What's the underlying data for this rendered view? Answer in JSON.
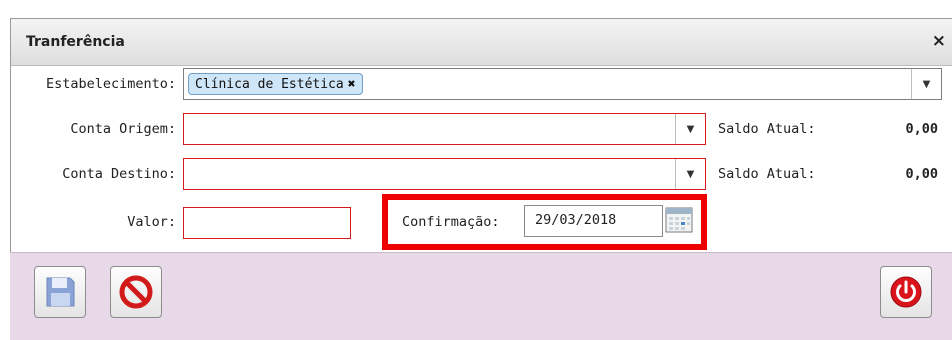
{
  "dialog": {
    "title": "Tranferência",
    "close_glyph": "×"
  },
  "form": {
    "estabelecimento_label": "Estabelecimento:",
    "estabelecimento_chip": "Clínica de Estética",
    "chip_remove": "✖",
    "conta_origem_label": "Conta Origem:",
    "conta_destino_label": "Conta Destino:",
    "saldo_label_1": "Saldo Atual:",
    "saldo_value_1": "0,00",
    "saldo_label_2": "Saldo Atual:",
    "saldo_value_2": "0,00",
    "valor_label": "Valor:",
    "confirmacao_label": "Confirmação:",
    "confirmacao_value": "29/03/2018"
  },
  "icons": {
    "dropdown": "▼",
    "save": "floppy-disk-icon",
    "cancel": "prohibited-icon",
    "power": "power-icon",
    "calendar": "calendar-icon"
  },
  "colors": {
    "required_border": "#d8191e",
    "highlight": "#ee0000",
    "footer_bg": "#e8d9e8",
    "chip_bg": "#cfe6f8"
  }
}
